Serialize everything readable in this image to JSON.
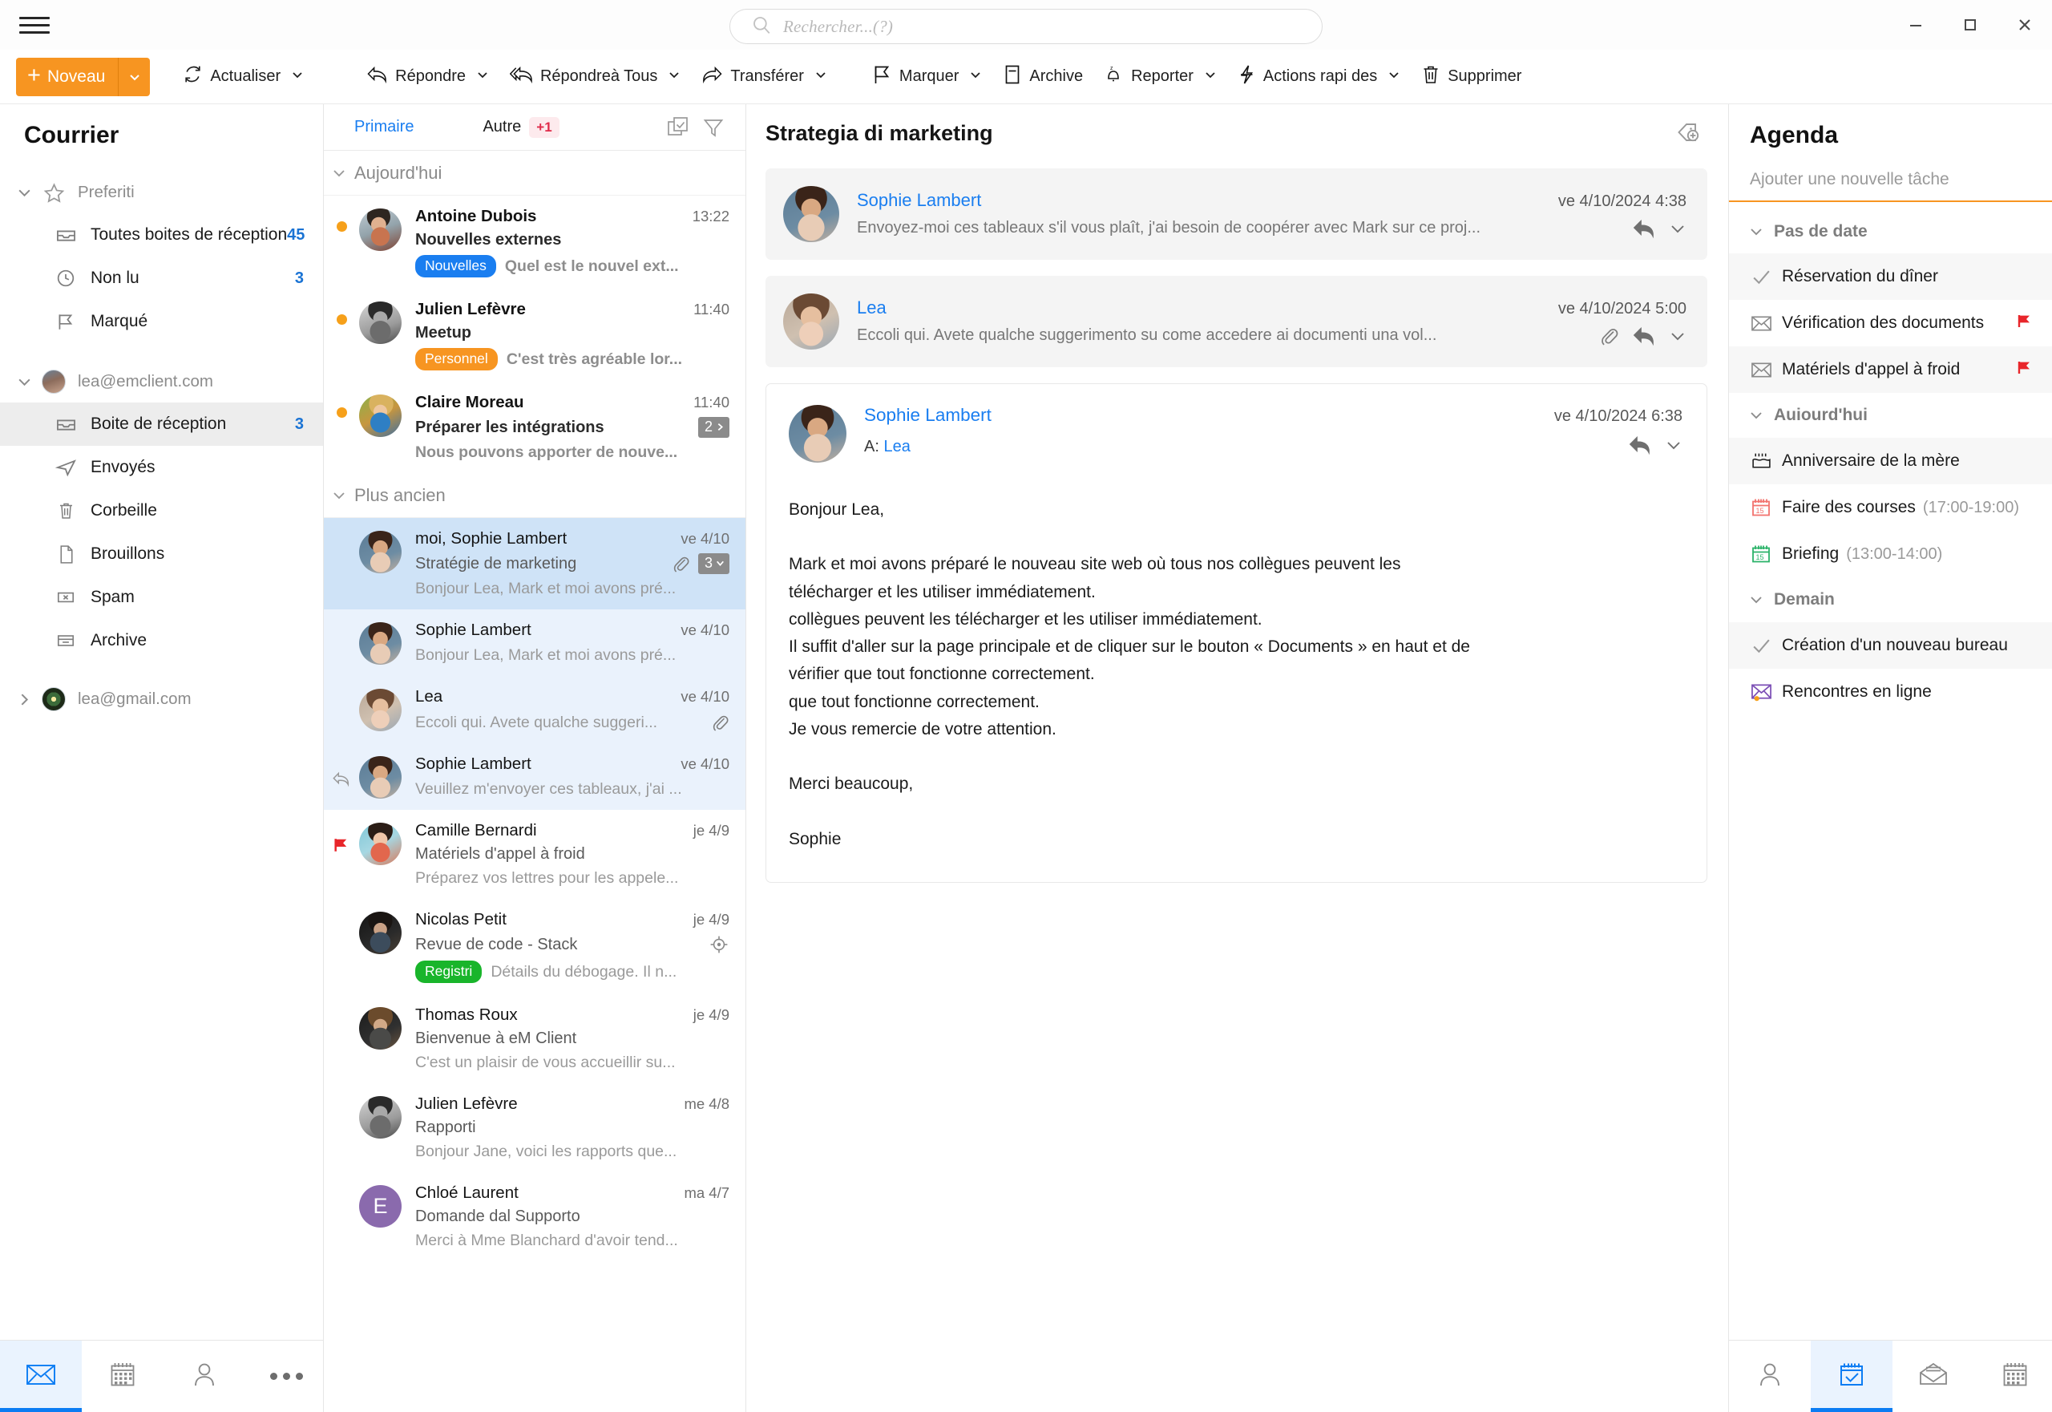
{
  "window": {
    "menu_icon": "hamburger-icon",
    "minimize_label": "—",
    "maximize_label": "☐",
    "close_label": "✕"
  },
  "search": {
    "placeholder": "Rechercher...(?)",
    "value": "",
    "icon": "search-icon"
  },
  "toolbar": {
    "new_label": "Noveau",
    "refresh_label": "Actualiser",
    "items": [
      {
        "label": "Répondre",
        "icon": "reply-icon",
        "caret": true
      },
      {
        "label": "Répondreà Tous",
        "icon": "reply-all-icon",
        "caret": true
      },
      {
        "label": "Transférer",
        "icon": "forward-icon",
        "caret": true
      },
      {
        "label": "Marquer",
        "icon": "flag-icon",
        "caret": true
      },
      {
        "label": "Archive",
        "icon": "archive-icon",
        "caret": false
      },
      {
        "label": "Reporter",
        "icon": "snooze-icon",
        "caret": true
      },
      {
        "label": "Actions rapi des",
        "icon": "lightning-icon",
        "caret": true
      },
      {
        "label": "Supprimer",
        "icon": "trash-icon",
        "caret": false
      }
    ]
  },
  "sidebar": {
    "title": "Courrier",
    "groups": [
      {
        "label": "Preferiti",
        "icon": "star-icon",
        "expanded": true,
        "items": [
          {
            "label": "Toutes boites de réception",
            "icon": "inbox-icon",
            "count": "45",
            "selected": false
          },
          {
            "label": "Non lu",
            "icon": "clock-icon",
            "count": "3",
            "selected": false
          },
          {
            "label": "Marqué",
            "icon": "flag-icon",
            "count": "",
            "selected": false
          }
        ]
      },
      {
        "label": "lea@emclient.com",
        "icon": "account-avatar",
        "expanded": true,
        "items": [
          {
            "label": "Boite de réception",
            "icon": "inbox-icon",
            "count": "3",
            "selected": true
          },
          {
            "label": "Envoyés",
            "icon": "sent-icon",
            "count": "",
            "selected": false
          },
          {
            "label": "Corbeille",
            "icon": "trash-icon",
            "count": "",
            "selected": false
          },
          {
            "label": "Brouillons",
            "icon": "draft-icon",
            "count": "",
            "selected": false
          },
          {
            "label": "Spam",
            "icon": "spam-icon",
            "count": "",
            "selected": false
          },
          {
            "label": "Archive",
            "icon": "archive-icon",
            "count": "",
            "selected": false
          }
        ]
      },
      {
        "label": "lea@gmail.com",
        "icon": "account-avatar-green",
        "expanded": false,
        "items": []
      }
    ],
    "bottom_nav": [
      {
        "icon": "mail-icon",
        "active": true
      },
      {
        "icon": "calendar-icon",
        "active": false
      },
      {
        "icon": "contacts-icon",
        "active": false
      },
      {
        "icon": "more-icon",
        "active": false
      }
    ]
  },
  "message_list": {
    "tabs": [
      {
        "label": "Primaire",
        "active": true
      },
      {
        "label": "Autre",
        "active": false,
        "badge": "+1"
      }
    ],
    "header_icons": [
      "select-all-icon",
      "filter-icon"
    ],
    "sections": [
      {
        "label": "Aujourd'hui",
        "expanded": true,
        "messages": [
          {
            "sender": "Antoine Dubois",
            "time": "13:22",
            "subject": "Nouvelles externes",
            "preview": "Quel est le nouvel ext...",
            "tag": {
              "text": "Nouvelles",
              "color": "#1a7ef0"
            },
            "unread": true,
            "avatar": "p-antoine",
            "state": ""
          },
          {
            "sender": "Julien Lefèvre",
            "time": "11:40",
            "subject": "Meetup",
            "preview": "C'est très agréable lor...",
            "tag": {
              "text": "Personnel",
              "color": "#f79521"
            },
            "unread": true,
            "avatar": "p-julien",
            "state": ""
          },
          {
            "sender": "Claire Moreau",
            "time": "11:40",
            "subject": "Préparer les intégrations",
            "preview": "Nous pouvons apporter de nouve...",
            "count_badge": "2",
            "unread": true,
            "avatar": "p-claire",
            "state": ""
          }
        ]
      },
      {
        "label": "Plus ancien",
        "expanded": true,
        "messages": [
          {
            "sender": "moi, Sophie Lambert",
            "time": "ve 4/10",
            "subject": "Stratégie de marketing",
            "preview": "Bonjour Lea, Mark et moi avons pré...",
            "attachment": true,
            "count_badge": "3",
            "unread": false,
            "avatar": "p-sophie",
            "state": "sel"
          },
          {
            "sender": "Sophie Lambert",
            "time": "ve 4/10",
            "subject": "",
            "preview": "Bonjour Lea, Mark et moi avons pré...",
            "unread": false,
            "avatar": "p-sophie",
            "state": "thread"
          },
          {
            "sender": "Lea",
            "time": "ve 4/10",
            "subject": "",
            "preview": "Eccoli qui. Avete qualche suggeri...",
            "attachment": true,
            "unread": false,
            "avatar": "p-lea",
            "state": "thread"
          },
          {
            "sender": "Sophie Lambert",
            "time": "ve 4/10",
            "subject": "",
            "preview": "Veuillez m'envoyer ces tableaux, j'ai ...",
            "replied": true,
            "unread": false,
            "avatar": "p-sophie",
            "state": "thread"
          },
          {
            "sender": "Camille Bernardi",
            "time": "je 4/9",
            "subject": "Matériels d'appel à froid",
            "preview": "Préparez vos lettres pour les appele...",
            "flagged": true,
            "unread": false,
            "avatar": "p-camille",
            "state": ""
          },
          {
            "sender": "Nicolas Petit",
            "time": "je 4/9",
            "subject": "Revue de code - Stack",
            "preview": "Détails du débogage. Il n...",
            "tag": {
              "text": "Registri",
              "color": "#19b52b"
            },
            "target_icon": true,
            "unread": false,
            "avatar": "p-nicolas",
            "state": ""
          },
          {
            "sender": "Thomas Roux",
            "time": "je 4/9",
            "subject": "Bienvenue à eM Client",
            "preview": "C'est un plaisir de vous accueillir su...",
            "unread": false,
            "avatar": "p-thomas",
            "state": ""
          },
          {
            "sender": "Julien Lefèvre",
            "time": "me 4/8",
            "subject": "Rapporti",
            "preview": "Bonjour Jane, voici les rapports que...",
            "unread": false,
            "avatar": "p-julien",
            "state": ""
          },
          {
            "sender": "Chloé Laurent",
            "time": "ma 4/7",
            "subject": "Domande dal Supporto",
            "preview": "Merci à Mme Blanchard d'avoir tend...",
            "unread": false,
            "avatar": "init",
            "initial": "E",
            "state": ""
          }
        ]
      }
    ]
  },
  "reader": {
    "subject": "Strategia di marketing",
    "tag_button_icon": "add-tag-icon",
    "collapsed": [
      {
        "name": "Sophie Lambert",
        "date": "ve 4/10/2024 4:38",
        "preview": "Envoyez-moi ces tableaux s'il vous plaît, j'ai besoin de coopérer avec Mark sur ce proj...",
        "attachment": false,
        "avatar": "p-sophie"
      },
      {
        "name": "Lea",
        "date": "ve 4/10/2024 5:00",
        "preview": "Eccoli qui. Avete qualche suggerimento su come accedere ai documenti una vol...",
        "attachment": true,
        "avatar": "p-lea"
      }
    ],
    "open_message": {
      "name": "Sophie Lambert",
      "date": "ve 4/10/2024 6:38",
      "to_label": "A:",
      "to_value": "Lea",
      "avatar": "p-sophie",
      "lines": [
        "Bonjour Lea,",
        "",
        "Mark et moi avons préparé le nouveau site web où tous nos collègues peuvent les",
        "télécharger et les utiliser immédiatement.",
        "collègues peuvent les télécharger et les utiliser immédiatement.",
        "Il suffit d'aller sur la page principale et de cliquer sur le bouton « Documents » en haut et de",
        "vérifier que tout fonctionne correctement.",
        "que tout fonctionne correctement.",
        "Je vous remercie de votre attention.",
        "",
        "Merci beaucoup,",
        "",
        "Sophie"
      ]
    }
  },
  "agenda": {
    "title": "Agenda",
    "new_task_placeholder": "Ajouter une nouvelle tâche",
    "new_task_value": "",
    "sections": [
      {
        "label": "Pas de date",
        "expanded": true,
        "items": [
          {
            "label": "Réservation du dîner",
            "time": "",
            "icon": "check-icon",
            "flagged": false,
            "shaded": true
          },
          {
            "label": "Vérification des documents",
            "time": "",
            "icon": "envelope-icon",
            "flagged": true,
            "shaded": false
          },
          {
            "label": "Matériels d'appel à froid",
            "time": "",
            "icon": "envelope-icon",
            "flagged": true,
            "shaded": true
          }
        ]
      },
      {
        "label": "Auiourd'hui",
        "expanded": true,
        "items": [
          {
            "label": "Anniversaire de la mère",
            "time": "",
            "icon": "cake-icon",
            "flagged": false,
            "shaded": true
          },
          {
            "label": "Faire des courses",
            "time": "(17:00-19:00)",
            "icon": "calendar-red-icon",
            "flagged": false,
            "shaded": false
          },
          {
            "label": "Briefing",
            "time": "(13:00-14:00)",
            "icon": "calendar-green-icon",
            "flagged": false,
            "shaded": false
          }
        ]
      },
      {
        "label": "Demain",
        "expanded": true,
        "items": [
          {
            "label": "Création d'un nouveau bureau",
            "time": "",
            "icon": "check-icon",
            "flagged": false,
            "shaded": true
          },
          {
            "label": "Rencontres en ligne",
            "time": "",
            "icon": "envelope-purple-icon",
            "flagged": false,
            "shaded": false
          }
        ]
      }
    ],
    "bottom_nav": [
      {
        "icon": "contacts-icon",
        "active": false
      },
      {
        "icon": "tasks-calendar-icon",
        "active": true
      },
      {
        "icon": "open-mail-icon",
        "active": false
      },
      {
        "icon": "calendar-icon",
        "active": false
      }
    ]
  },
  "colors": {
    "accent_orange": "#f79521",
    "accent_blue": "#1a7ef0",
    "selected_row": "#cfe3f7",
    "thread_row": "#eaf2fc",
    "tag_news": "#1a7ef0",
    "tag_personal": "#f79521",
    "tag_registri": "#19b52b",
    "flag_red": "#e8262b"
  }
}
